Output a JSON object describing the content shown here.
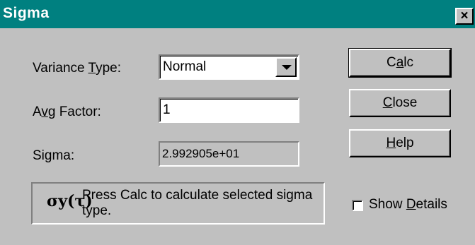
{
  "window": {
    "title": "Sigma",
    "close_glyph": "×"
  },
  "form": {
    "variance_type_label_pre": "Variance ",
    "variance_type_label_key": "T",
    "variance_type_label_post": "ype:",
    "variance_type_value": "Normal",
    "avg_factor_label_pre": "A",
    "avg_factor_label_key": "v",
    "avg_factor_label_post": "g Factor:",
    "avg_factor_value": "1",
    "sigma_label": "Sigma:",
    "sigma_value": "2.992905e+01"
  },
  "buttons": {
    "calc_pre": "C",
    "calc_key": "a",
    "calc_post": "lc",
    "close_key": "C",
    "close_post": "lose",
    "help_key": "H",
    "help_post": "elp"
  },
  "message": {
    "icon_text": "σy(τ)",
    "text": "Press Calc to calculate selected sigma type."
  },
  "options": {
    "show_details_pre": "Show ",
    "show_details_key": "D",
    "show_details_post": "etails",
    "show_details_checked": false
  }
}
